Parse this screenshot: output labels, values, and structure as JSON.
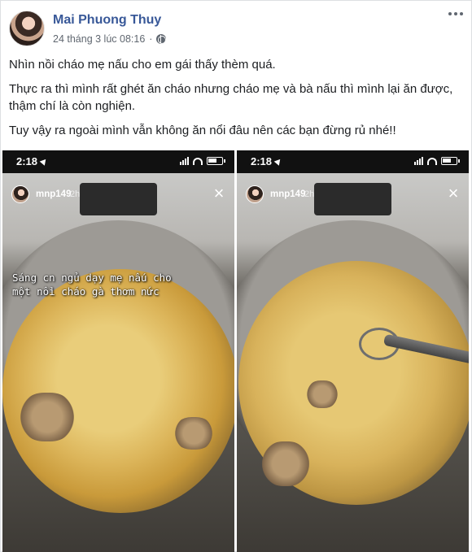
{
  "post": {
    "author": "Mai Phuong Thuy",
    "timestamp": "24 tháng 3 lúc 08:16",
    "privacy_icon": "globe-icon",
    "more_icon": "more-options-icon",
    "paragraphs": [
      "Nhìn nồi cháo mẹ nấu cho em gái thấy thèm quá.",
      "Thực ra thì mình rất ghét ăn cháo nhưng cháo mẹ và bà nấu thì mình lại ăn được, thậm chí là còn nghiện.",
      "Tuy vậy ra ngoài mình vẫn không ăn nổi đâu nên các bạn đừng rủ nhé!!"
    ]
  },
  "photos": [
    {
      "status_time": "2:18",
      "story_user": "mnp149",
      "story_age": "2h",
      "close_icon": "×",
      "caption_lines": [
        "Sáng cn ngủ dạy mẹ nấu cho",
        "một nồi cháo gà thơm nức"
      ]
    },
    {
      "status_time": "2:18",
      "story_user": "mnp149",
      "story_age": "2h",
      "close_icon": "×"
    }
  ],
  "colors": {
    "author_link": "#385898",
    "meta_text": "#606770",
    "body_text": "#1c1e21"
  }
}
